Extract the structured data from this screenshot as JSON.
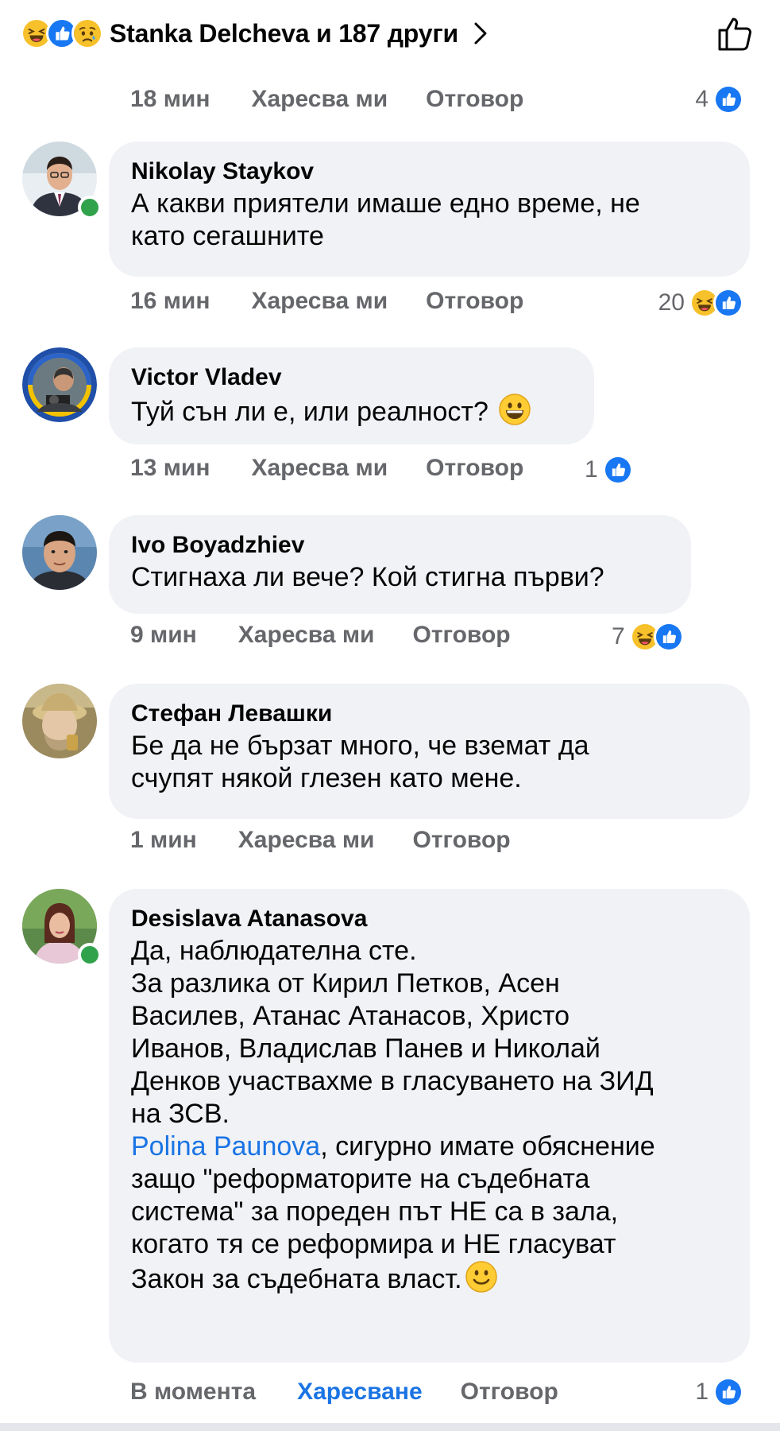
{
  "top": {
    "text": "Stanka Delcheva и 187 други",
    "reactions": [
      "haha",
      "like",
      "sad"
    ]
  },
  "first_meta": {
    "time": "18 мин",
    "like": "Харесва ми",
    "reply": "Отговор",
    "count": "4"
  },
  "comments": [
    {
      "name": "Nikolay Staykov",
      "text": "А какви приятели имаше едно време, не\nкато сегашните",
      "time": "16 мин",
      "like": "Харесва ми",
      "reply": "Отговор",
      "count": "20",
      "online": true
    },
    {
      "name": "Victor Vladev",
      "text": "Туй сън ли е, или реалност?",
      "time": "13 мин",
      "like": "Харесва ми",
      "reply": "Отговор",
      "count": "1"
    },
    {
      "name": "Ivo Boyadzhiev",
      "text": "Стигнаха ли вече? Кой стигна първи?",
      "time": "9 мин",
      "like": "Харесва ми",
      "reply": "Отговор",
      "count": "7"
    },
    {
      "name": "Стефан Левашки",
      "text": "Бе да не бързат много, че вземат да\nсчупят някой глезен като мене.",
      "time": "1 мин",
      "like": "Харесва ми",
      "reply": "Отговор"
    },
    {
      "name": "Desislava Atanasova",
      "text_a": "Да, наблюдателна сте.\nЗа разлика от Кирил Петков, Асен\nВасилев, Атанас Атанасов, Христо\nИванов, Владислав Панев и Николай\nДенков участвахме в гласуването на ЗИД\nна ЗСВ.\n",
      "mention": "Polina Paunova",
      "text_b": ", сигурно имате обяснение\nзащо \"реформаторите на съдебната\nсистема\" за пореден път НЕ са в зала,\nкогато тя се реформира и НЕ гласуват\nЗакон за съдебната власт.",
      "time": "В момента",
      "like": "Харесване",
      "reply": "Отговор",
      "count": "1",
      "online": true
    }
  ],
  "colors": {
    "bubble": "#f0f2f5",
    "meta": "#65676b",
    "accent": "#1b74e4",
    "online": "#31a24c"
  }
}
